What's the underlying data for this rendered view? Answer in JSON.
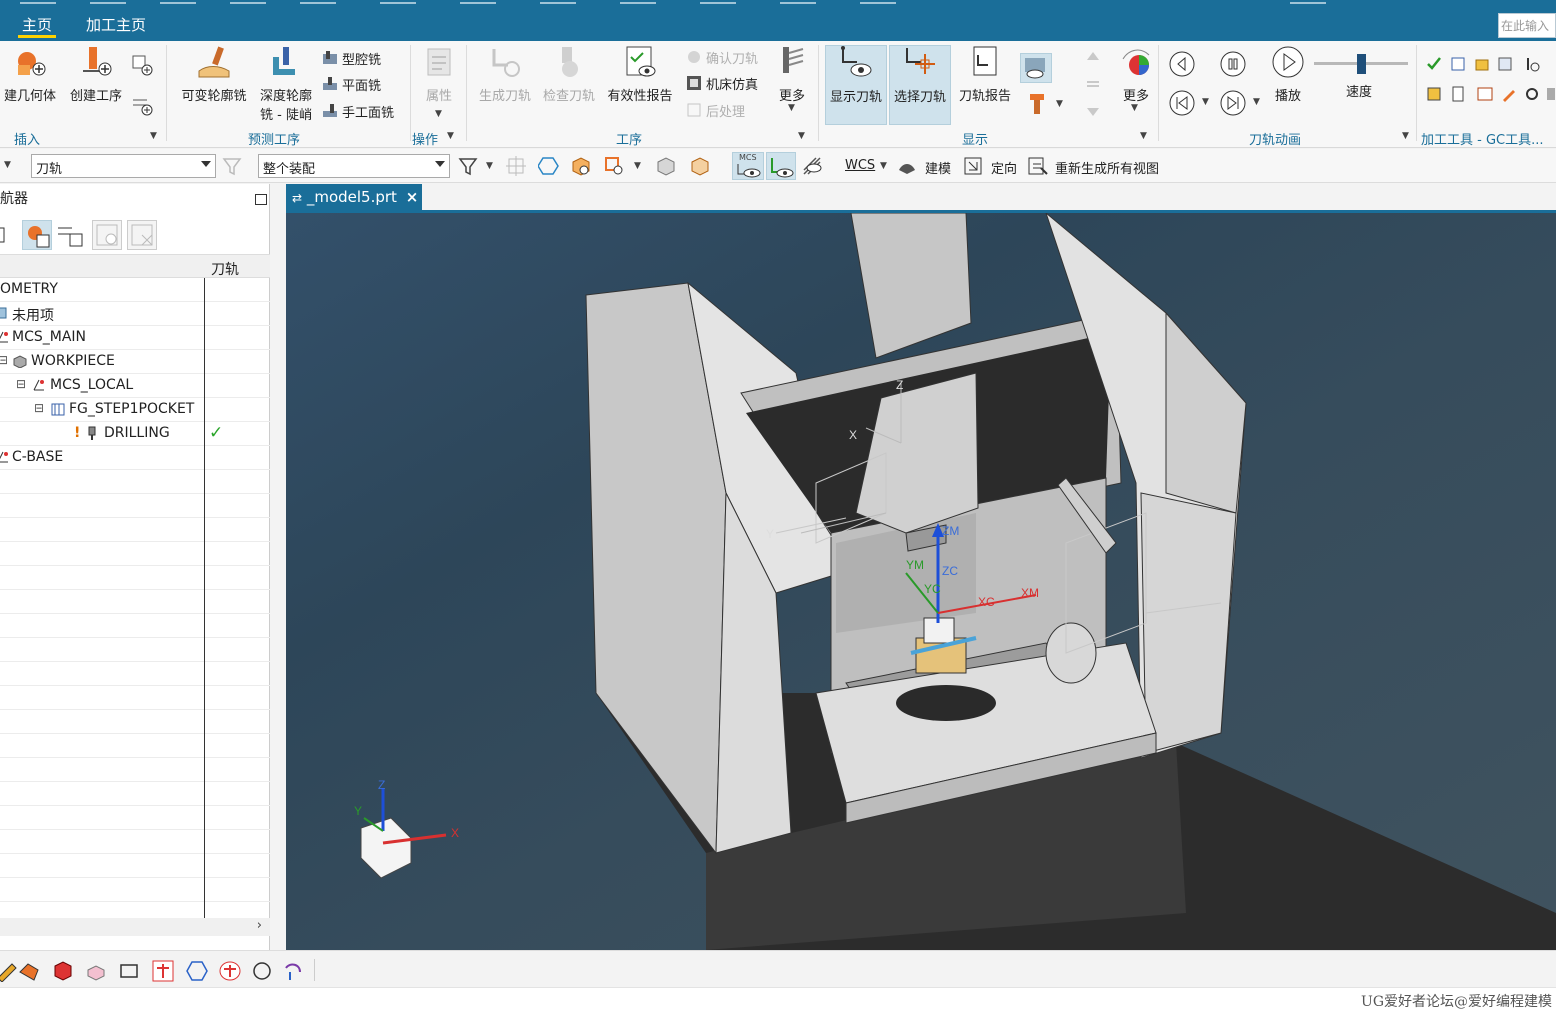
{
  "ribbon_tabs": {
    "home": "主页",
    "machining_home": "加工主页"
  },
  "search_placeholder": "在此输入",
  "groups": {
    "insert": {
      "label": "插入",
      "create_geometry": "建几何体",
      "create_operation": "创建工序"
    },
    "predict": {
      "label": "预测工序",
      "variable_contour": "可变轮廓铣",
      "depth_contour_1": "深度轮廓",
      "depth_contour_2": "铣 - 陡峭",
      "cavity_mill": "型腔铣",
      "face_mill": "平面铣",
      "manual_face_mill": "手工面铣"
    },
    "operate": {
      "label": "操作",
      "properties": "属性"
    },
    "operation": {
      "label": "工序",
      "generate_path": "生成刀轨",
      "verify_path": "检查刀轨",
      "validity_report": "有效性报告",
      "confirm_path": "确认刀轨",
      "machine_sim": "机床仿真",
      "post_process": "后处理",
      "more": "更多"
    },
    "display": {
      "label": "显示",
      "show_path": "显示刀轨",
      "select_path": "选择刀轨",
      "path_report": "刀轨报告",
      "more": "更多"
    },
    "animation": {
      "label": "刀轨动画",
      "play": "播放",
      "speed": "速度",
      "speed_level": 0.5
    },
    "tools": {
      "label": "加工工具 - GC工具..."
    }
  },
  "toolbar2": {
    "filter_combo": "刀轨",
    "assembly_combo": "整个装配",
    "mcs_tag": "MCS",
    "wcs": "WCS",
    "model": "建模",
    "orient": "定向",
    "regen_all": "重新生成所有视图"
  },
  "nav": {
    "title": "航器",
    "col_path": "刀轨",
    "rows": [
      {
        "label": "OMETRY",
        "check": ""
      },
      {
        "label": "未用项",
        "check": ""
      },
      {
        "label": "MCS_MAIN",
        "check": ""
      },
      {
        "label": "WORKPIECE",
        "check": ""
      },
      {
        "label": "MCS_LOCAL",
        "check": ""
      },
      {
        "label": "FG_STEP1POCKET",
        "check": ""
      },
      {
        "label": "DRILLING",
        "check": "✓"
      },
      {
        "label": "C-BASE",
        "check": ""
      }
    ]
  },
  "viewport": {
    "tab": "_model5.prt",
    "labels": {
      "zm": "ZM",
      "zc": "ZC",
      "ym": "YM",
      "yc": "YC",
      "xc": "XC",
      "xm": "XM",
      "x": "X",
      "y": "Y",
      "z": "Z"
    }
  },
  "watermark": "UG爱好者论坛@爱好编程建模"
}
